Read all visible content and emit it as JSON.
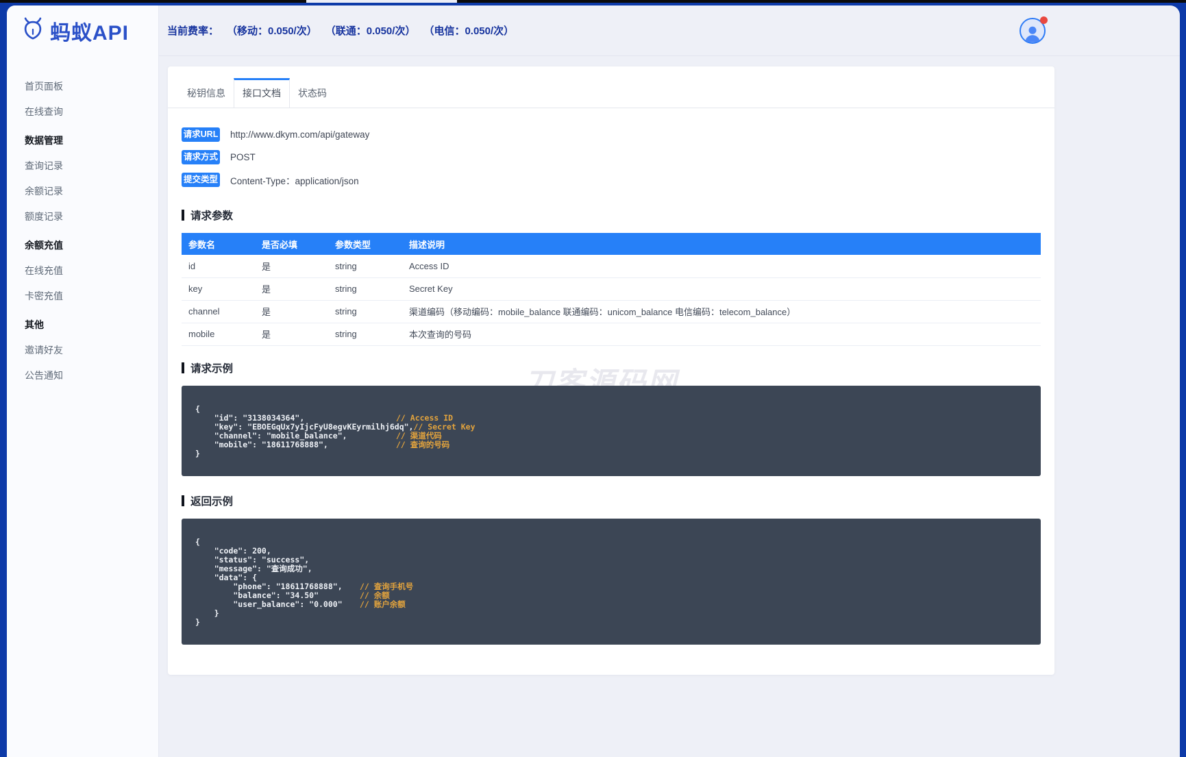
{
  "colors": {
    "frame_blue": "#0d3aa8",
    "accent_blue": "#2680f8",
    "logo_blue": "#2a50c8",
    "fee_text_blue": "#16339e",
    "code_bg": "#3c4655",
    "comment_orange": "#e2a33d",
    "notification_red": "#e9483f"
  },
  "sidebar": {
    "logo_text": "蚂蚁API",
    "items": [
      {
        "label": "首页面板",
        "type": "link"
      },
      {
        "label": "在线查询",
        "type": "link"
      },
      {
        "label": "数据管理",
        "type": "section"
      },
      {
        "label": "查询记录",
        "type": "link"
      },
      {
        "label": "余额记录",
        "type": "link"
      },
      {
        "label": "额度记录",
        "type": "link"
      },
      {
        "label": "余额充值",
        "type": "section"
      },
      {
        "label": "在线充值",
        "type": "link"
      },
      {
        "label": "卡密充值",
        "type": "link"
      },
      {
        "label": "其他",
        "type": "section"
      },
      {
        "label": "邀请好友",
        "type": "link"
      },
      {
        "label": "公告通知",
        "type": "link"
      }
    ]
  },
  "header": {
    "rate_label": "当前费率：",
    "rates": [
      "（移动：0.050/次）",
      "（联通：0.050/次）",
      "（电信：0.050/次）"
    ]
  },
  "tabs": [
    {
      "label": "秘钥信息",
      "active": false
    },
    {
      "label": "接口文档",
      "active": true
    },
    {
      "label": "状态码",
      "active": false
    }
  ],
  "meta": [
    {
      "badge": "请求URL",
      "value": "http://www.dkym.com/api/gateway"
    },
    {
      "badge": "请求方式",
      "value": "POST"
    },
    {
      "badge": "提交类型",
      "value": "Content-Type：application/json"
    }
  ],
  "params_section": {
    "title": "请求参数",
    "table": {
      "headers": [
        "参数名",
        "是否必填",
        "参数类型",
        "描述说明"
      ],
      "rows": [
        [
          "id",
          "是",
          "string",
          "Access ID"
        ],
        [
          "key",
          "是",
          "string",
          "Secret Key"
        ],
        [
          "channel",
          "是",
          "string",
          "渠道编码（移动编码：mobile_balance 联通编码：unicom_balance 电信编码：telecom_balance）"
        ],
        [
          "mobile",
          "是",
          "string",
          "本次查询的号码"
        ]
      ]
    }
  },
  "request_example": {
    "title": "请求示例",
    "lines": [
      {
        "code": "{",
        "comment": ""
      },
      {
        "code": "    \"id\": \"3138034364\",",
        "comment": "// Access ID"
      },
      {
        "code": "    \"key\": \"EBOEGqUx7yIjcFyU8egvKEyrmilhj6dq\",",
        "comment": "// Secret Key"
      },
      {
        "code": "    \"channel\": \"mobile_balance\",",
        "comment": "// 渠道代码"
      },
      {
        "code": "    \"mobile\": \"18611768888\",",
        "comment": "// 查询的号码"
      },
      {
        "code": "}",
        "comment": ""
      }
    ]
  },
  "response_example": {
    "title": "返回示例",
    "lines": [
      {
        "code": "{",
        "comment": ""
      },
      {
        "code": "    \"code\": 200,",
        "comment": ""
      },
      {
        "code": "    \"status\": \"success\",",
        "comment": ""
      },
      {
        "code": "    \"message\": \"查询成功\",",
        "comment": ""
      },
      {
        "code": "    \"data\": {",
        "comment": ""
      },
      {
        "code": "        \"phone\": \"18611768888\",",
        "comment": "// 查询手机号"
      },
      {
        "code": "        \"balance\": \"34.50\"",
        "comment": "// 余额"
      },
      {
        "code": "        \"user_balance\": \"0.000\"",
        "comment": "// 账户余额"
      },
      {
        "code": "    }",
        "comment": ""
      },
      {
        "code": "}",
        "comment": ""
      }
    ]
  },
  "watermark": "刀客源码网"
}
